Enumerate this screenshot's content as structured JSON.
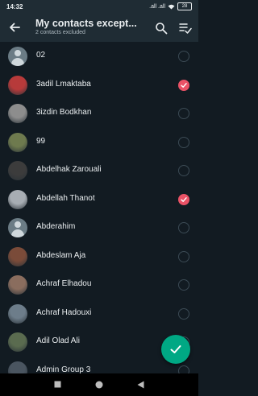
{
  "status": {
    "time": "14:32",
    "signal": ".all .all",
    "battery": "28"
  },
  "header": {
    "title": "My contacts except...",
    "subtitle": "2 contacts excluded"
  },
  "contacts": [
    {
      "name": "02",
      "avatar": "default",
      "selected": false
    },
    {
      "name": "3adil Lmaktaba",
      "avatar": "photo",
      "color": "#b73a3a",
      "selected": true
    },
    {
      "name": "3izdin Bodkhan",
      "avatar": "photo",
      "color": "#8d8d8d",
      "selected": false
    },
    {
      "name": "99",
      "avatar": "photo",
      "color": "#6e7a4e",
      "selected": false
    },
    {
      "name": "Abdelhak Zarouali",
      "avatar": "photo",
      "color": "#3c3c3c",
      "selected": false
    },
    {
      "name": "Abdellah Thanot",
      "avatar": "photo",
      "color": "#a7adb3",
      "selected": true
    },
    {
      "name": "Abderahim",
      "avatar": "default",
      "selected": false
    },
    {
      "name": "Abdeslam Aja",
      "avatar": "photo",
      "color": "#7a4b39",
      "selected": false
    },
    {
      "name": "Achraf Elhadou",
      "avatar": "photo",
      "color": "#8a6d5e",
      "selected": false
    },
    {
      "name": "Achraf Hadouxi",
      "avatar": "photo",
      "color": "#6d7d8a",
      "selected": false
    },
    {
      "name": "Adil Olad Ali",
      "avatar": "photo",
      "color": "#5a6b4f",
      "selected": false
    },
    {
      "name": "Admin Group 3",
      "avatar": "photo",
      "color": "#4a5560",
      "selected": false
    }
  ],
  "colors": {
    "accent": "#00a884",
    "check": "#ea5266",
    "background": "#121b22",
    "appbar": "#1f2c34"
  },
  "icons": {
    "back": "arrow-left-icon",
    "search": "search-icon",
    "select_all": "select-all-icon",
    "fab": "check-icon",
    "nav": [
      "square-icon",
      "circle-icon",
      "triangle-back-icon"
    ]
  }
}
